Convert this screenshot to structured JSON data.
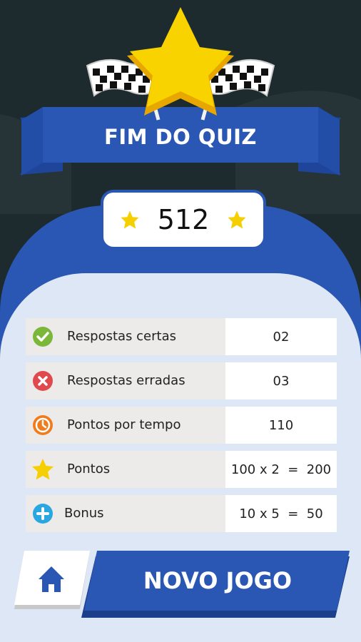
{
  "header": {
    "title": "FIM DO QUIZ"
  },
  "score": {
    "value": "512"
  },
  "stats": [
    {
      "label": "Respostas certas",
      "value": "02",
      "icon": "check-icon",
      "color": "#7bb83a"
    },
    {
      "label": "Respostas erradas",
      "value": "03",
      "icon": "x-icon",
      "color": "#e04a4f"
    },
    {
      "label": "Pontos por tempo",
      "value": "110",
      "icon": "clock-icon",
      "color": "#ef7d1e"
    },
    {
      "label": "Pontos",
      "value": "100 x 2  =  200",
      "icon": "star-icon",
      "color": "#f6cf00"
    },
    {
      "label": "Bonus",
      "value": "10 x 5  =  50",
      "icon": "plus-icon",
      "color": "#2aa7e0"
    }
  ],
  "actions": {
    "new_game_label": "NOVO JOGO",
    "home_icon": "home-icon"
  },
  "colors": {
    "primary_blue": "#2a57b3",
    "panel_light": "#dde7f5",
    "background": "#1d2a2e",
    "gold": "#f6cf00"
  }
}
